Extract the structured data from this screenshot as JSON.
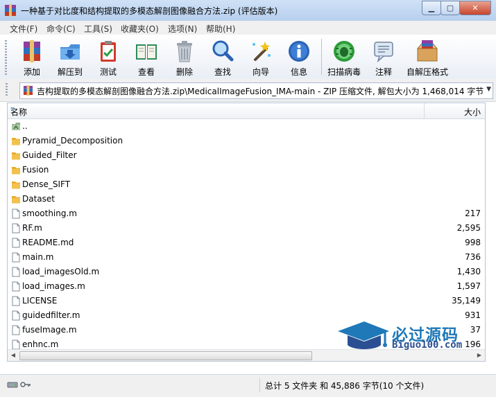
{
  "window": {
    "title": "一种基于对比度和结构提取的多模态解剖图像融合方法.zip (评估版本)",
    "minimize_glyph": "▁",
    "maximize_glyph": "▢",
    "close_glyph": "✕"
  },
  "menu": [
    "文件(F)",
    "命令(C)",
    "工具(S)",
    "收藏夹(O)",
    "选项(N)",
    "帮助(H)"
  ],
  "toolbar": [
    {
      "label": "添加",
      "icon": "add-archive-icon"
    },
    {
      "label": "解压到",
      "icon": "extract-to-icon"
    },
    {
      "label": "测试",
      "icon": "test-clipboard-icon"
    },
    {
      "label": "查看",
      "icon": "view-book-icon"
    },
    {
      "label": "删除",
      "icon": "trash-icon"
    },
    {
      "label": "查找",
      "icon": "magnifier-icon"
    },
    {
      "label": "向导",
      "icon": "wizard-wand-icon"
    },
    {
      "label": "信息",
      "icon": "info-icon"
    },
    {
      "label": "扫描病毒",
      "icon": "virus-scan-icon"
    },
    {
      "label": "注释",
      "icon": "comment-icon"
    },
    {
      "label": "自解压格式",
      "icon": "sfx-box-icon"
    }
  ],
  "address": {
    "path": "吉构提取的多模态解剖图像融合方法.zip\\MedicalImageFusion_IMA-main - ZIP 压缩文件, 解包大小为 1,468,014 字节"
  },
  "columns": {
    "name": "名称",
    "size": "大小"
  },
  "files": [
    {
      "name": "..",
      "size": "",
      "type": "up"
    },
    {
      "name": "Pyramid_Decomposition",
      "size": "",
      "type": "folder"
    },
    {
      "name": "Guided_Filter",
      "size": "",
      "type": "folder"
    },
    {
      "name": "Fusion",
      "size": "",
      "type": "folder"
    },
    {
      "name": "Dense_SIFT",
      "size": "",
      "type": "folder"
    },
    {
      "name": "Dataset",
      "size": "",
      "type": "folder"
    },
    {
      "name": "smoothing.m",
      "size": "217",
      "type": "file"
    },
    {
      "name": "RF.m",
      "size": "2,595",
      "type": "file"
    },
    {
      "name": "README.md",
      "size": "998",
      "type": "file"
    },
    {
      "name": "main.m",
      "size": "736",
      "type": "file"
    },
    {
      "name": "load_imagesOld.m",
      "size": "1,430",
      "type": "file"
    },
    {
      "name": "load_images.m",
      "size": "1,597",
      "type": "file"
    },
    {
      "name": "LICENSE",
      "size": "35,149",
      "type": "file"
    },
    {
      "name": "guidedfilter.m",
      "size": "931",
      "type": "file"
    },
    {
      "name": "fuseImage.m",
      "size": "37",
      "type": "file"
    },
    {
      "name": "enhnc.m",
      "size": "196",
      "type": "file"
    }
  ],
  "status": {
    "summary": "总计 5 文件夹 和 45,886 字节(10 个文件)"
  },
  "watermark": {
    "main": "必过源码",
    "sub": "Biguo100.com"
  },
  "colors": {
    "accent": "#1f78b8",
    "folder": "#f2c14e",
    "title_bg": "#c4d9f2"
  }
}
